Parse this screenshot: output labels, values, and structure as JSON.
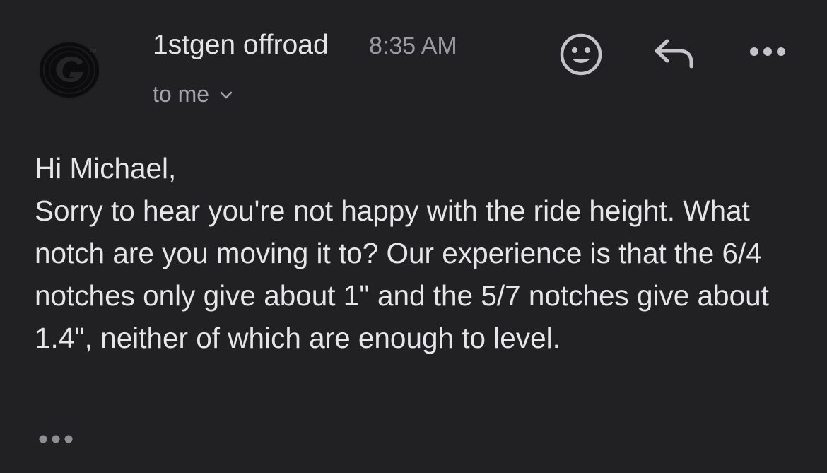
{
  "header": {
    "sender_name": "1stgen offroad",
    "time": "8:35 AM",
    "recipient_label": "to me",
    "avatar_icon": "tire-g-logo",
    "actions": {
      "emoji": "smiley-face-icon",
      "reply": "reply-arrow-icon",
      "more": "more-horizontal-icon"
    }
  },
  "message": {
    "greeting": "Hi Michael,",
    "body": "Sorry to hear you're not happy with the ride height.  What notch are you moving it to?  Our experience is that the 6/4 notches only give about 1\" and the 5/7 notches give about 1.4\", neither of which are enough to level."
  },
  "trimmed_content_icon": "ellipsis-icon",
  "colors": {
    "background": "#212124",
    "primary_text": "#e4e4e7",
    "secondary_text": "#9a9a9f",
    "icon": "#c4c4c9"
  }
}
